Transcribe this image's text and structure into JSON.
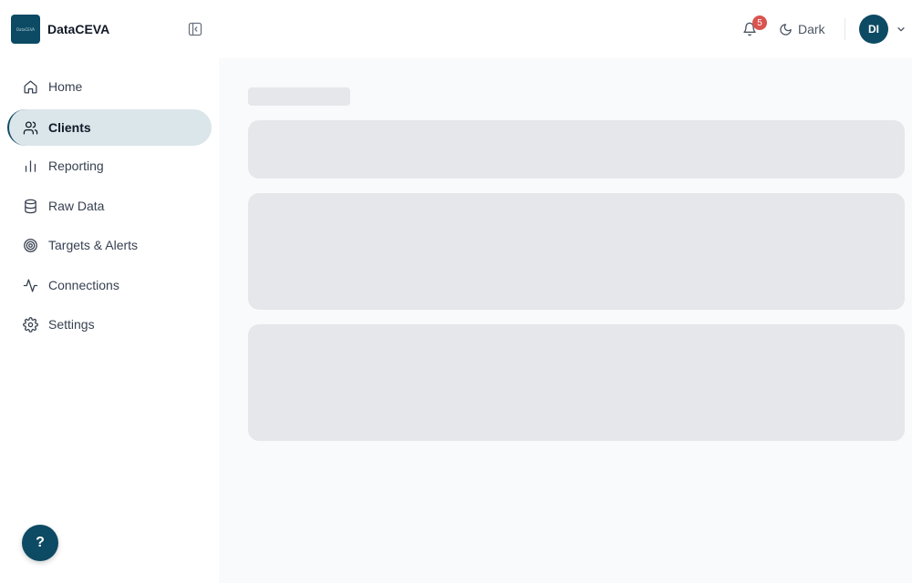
{
  "app": {
    "name": "DataCEVA",
    "logo_text": "DataCEVA"
  },
  "header": {
    "notifications_count": "5",
    "theme_label": "Dark",
    "user_initials": "DI"
  },
  "sidebar": {
    "items": [
      {
        "label": "Home",
        "icon": "home-icon",
        "active": false
      },
      {
        "label": "Clients",
        "icon": "users-icon",
        "active": true
      },
      {
        "label": "Reporting",
        "icon": "bar-chart-icon",
        "active": false
      },
      {
        "label": "Raw Data",
        "icon": "database-icon",
        "active": false
      },
      {
        "label": "Targets & Alerts",
        "icon": "target-icon",
        "active": false
      },
      {
        "label": "Connections",
        "icon": "activity-icon",
        "active": false
      },
      {
        "label": "Settings",
        "icon": "gear-icon",
        "active": false
      }
    ]
  },
  "help": {
    "label": "?"
  },
  "colors": {
    "brand": "#0d4a63",
    "active_bg": "#dbe6ea",
    "badge": "#d9534f",
    "skeleton": "#e5e7eb",
    "main_bg": "#f9fafb"
  }
}
